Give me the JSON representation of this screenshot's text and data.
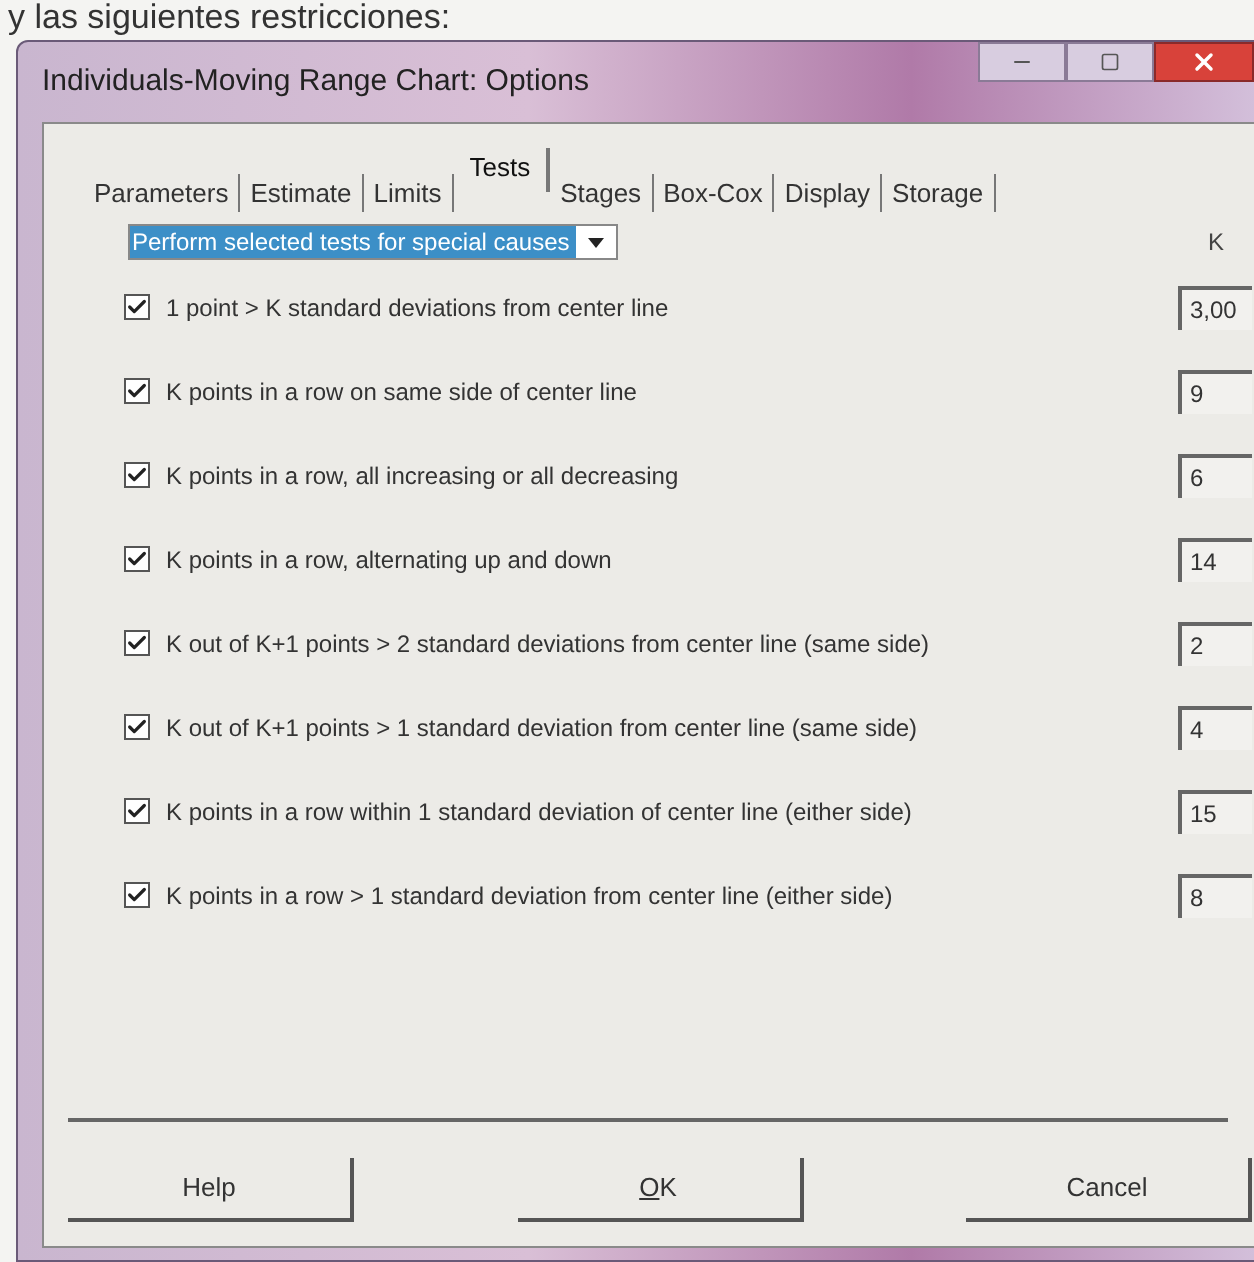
{
  "document_text": "y las siguientes restricciones:",
  "window": {
    "title": "Individuals-Moving Range Chart: Options"
  },
  "tabs": [
    {
      "label": "Parameters",
      "selected": false
    },
    {
      "label": "Estimate",
      "selected": false
    },
    {
      "label": "Limits",
      "selected": false
    },
    {
      "label": "Tests",
      "selected": true
    },
    {
      "label": "Stages",
      "selected": false
    },
    {
      "label": "Box-Cox",
      "selected": false
    },
    {
      "label": "Display",
      "selected": false
    },
    {
      "label": "Storage",
      "selected": false
    }
  ],
  "test_mode": {
    "value": "Perform selected tests for special causes"
  },
  "k_header": "K",
  "tests": [
    {
      "label": "1 point > K standard deviations from center line",
      "checked": true,
      "k": "3,00"
    },
    {
      "label": "K points in a row on same side of center line",
      "checked": true,
      "k": "9"
    },
    {
      "label": "K points in a row, all increasing or all decreasing",
      "checked": true,
      "k": "6"
    },
    {
      "label": "K points in a row, alternating up and down",
      "checked": true,
      "k": "14"
    },
    {
      "label": "K out of K+1 points > 2 standard deviations from center line (same side)",
      "checked": true,
      "k": "2"
    },
    {
      "label": "K out of K+1 points > 1 standard deviation from center line (same side)",
      "checked": true,
      "k": "4"
    },
    {
      "label": "K points in a row within 1 standard deviation of center line (either side)",
      "checked": true,
      "k": "15"
    },
    {
      "label": "K points in a row > 1 standard deviation from center line (either side)",
      "checked": true,
      "k": "8"
    }
  ],
  "buttons": [
    {
      "label": "Help",
      "mnemonic_underlined": false
    },
    {
      "label": "OK",
      "mnemonic_underlined": true
    },
    {
      "label": "Cancel",
      "mnemonic_underlined": false
    }
  ]
}
